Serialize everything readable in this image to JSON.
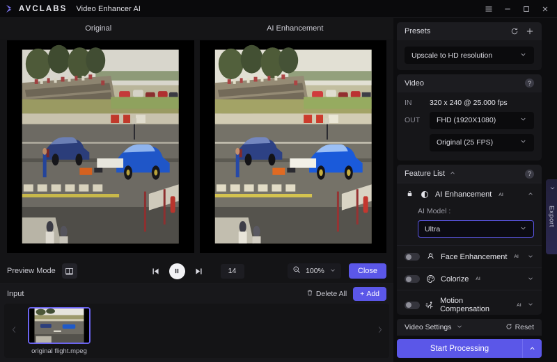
{
  "titlebar": {
    "brand": "AVCLABS",
    "app_title": "Video Enhancer AI",
    "menu_icon": "hamburger-icon",
    "minimize_icon": "minimize-icon",
    "maximize_icon": "maximize-icon",
    "close_icon": "close-icon"
  },
  "preview": {
    "left_header": "Original",
    "right_header": "AI Enhancement"
  },
  "playbar": {
    "preview_mode_label": "Preview Mode",
    "split_view_icon": "split-view-icon",
    "prev_frame_icon": "previous-frame-icon",
    "pause_icon": "pause-icon",
    "next_frame_icon": "next-frame-icon",
    "frame_number": "14",
    "zoom_icon": "zoom-icon",
    "zoom_level": "100%",
    "zoom_chevron": "chevron-down-icon",
    "close_label": "Close"
  },
  "input": {
    "title": "Input",
    "delete_all_label": "Delete All",
    "delete_icon": "trash-icon",
    "add_label": "Add",
    "add_icon": "plus-icon",
    "prev_icon": "chevron-left-icon",
    "next_icon": "chevron-right-icon",
    "items": [
      {
        "filename": "original flight.mpeg",
        "selected": true
      }
    ]
  },
  "presets": {
    "title": "Presets",
    "refresh_icon": "refresh-icon",
    "add_icon": "plus-icon",
    "selected": "Upscale to HD resolution",
    "chevron": "chevron-down-icon"
  },
  "video": {
    "title": "Video",
    "help_icon": "help-icon",
    "in_label": "IN",
    "in_value_res": "320 x 240",
    "in_value_at": "@",
    "in_value_fps": "25.000 fps",
    "in_value_full": "320 x 240 @ 25.000 fps",
    "out_label": "OUT",
    "out_resolution": "FHD (1920X1080)",
    "out_framerate": "Original (25 FPS)",
    "chevron": "chevron-down-icon"
  },
  "feature_list": {
    "title": "Feature List",
    "collapse_icon": "chevron-up-icon",
    "help_icon": "help-icon",
    "items": [
      {
        "name": "AI Enhancement",
        "superscript": "AI",
        "icon": "contrast-icon",
        "locked": true,
        "lock_icon": "lock-icon",
        "expanded": true,
        "chevron": "chevron-up-icon",
        "model_label": "AI Model :",
        "model_value": "Ultra",
        "model_chevron": "chevron-down-icon"
      },
      {
        "name": "Face Enhancement",
        "superscript": "AI",
        "icon": "face-icon",
        "locked": false,
        "enabled": false,
        "chevron": "chevron-down-icon"
      },
      {
        "name": "Colorize",
        "superscript": "AI",
        "icon": "palette-icon",
        "locked": false,
        "enabled": false,
        "chevron": "chevron-down-icon"
      },
      {
        "name": "Motion Compensation",
        "superscript": "AI",
        "icon": "running-person-icon",
        "locked": false,
        "enabled": false,
        "chevron": "chevron-down-icon"
      }
    ]
  },
  "video_settings": {
    "label": "Video Settings",
    "chevron": "chevron-down-icon",
    "reset_label": "Reset",
    "reset_icon": "refresh-icon"
  },
  "start": {
    "label": "Start Processing",
    "caret_icon": "chevron-up-icon"
  },
  "export": {
    "label": "Export",
    "chevron": "chevron-right-icon"
  },
  "colors": {
    "accent": "#5b57e8",
    "window_bg": "#111113",
    "panel_bg": "#161619",
    "card_head_bg": "#1c1c20"
  }
}
